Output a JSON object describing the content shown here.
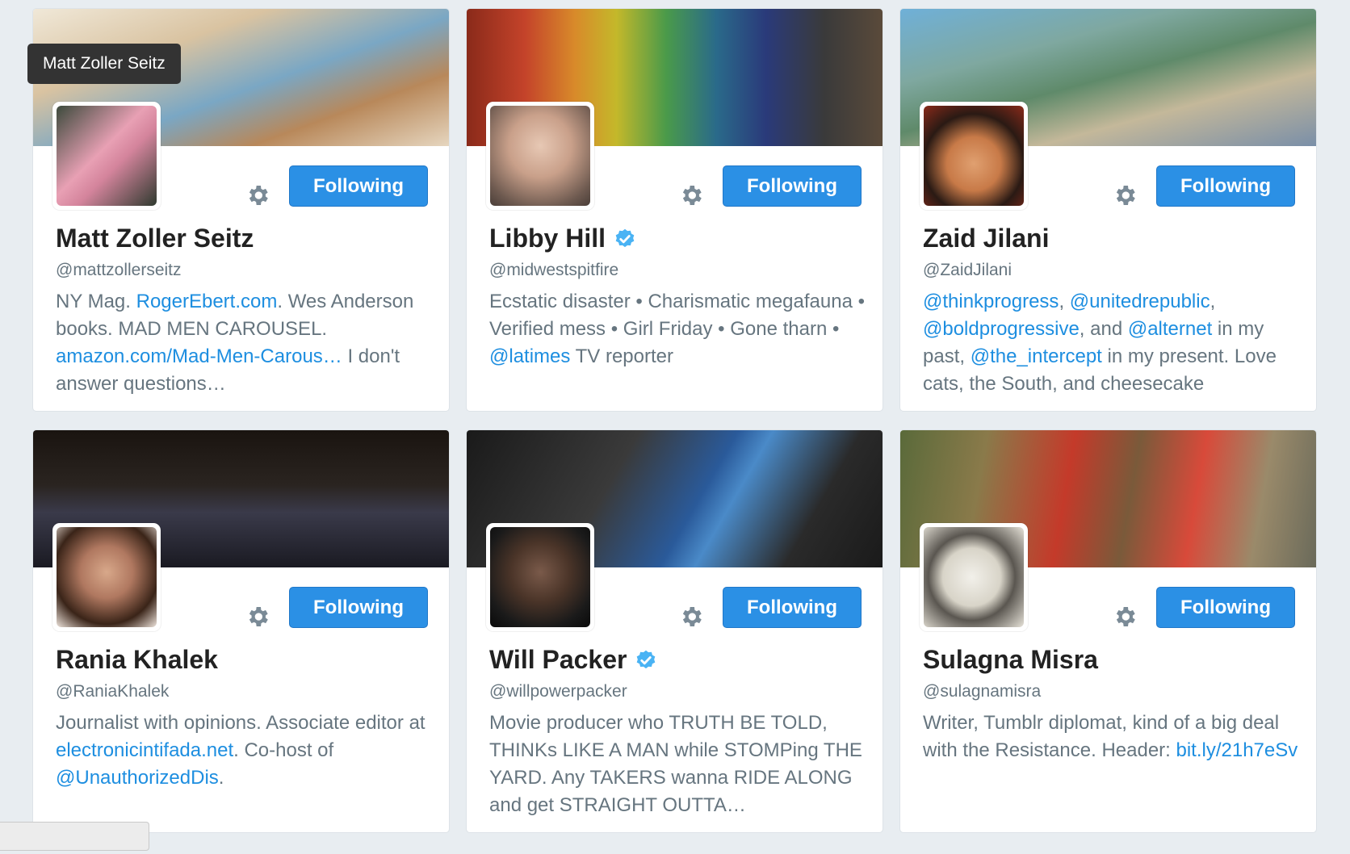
{
  "tooltip": "Matt Zoller Seitz",
  "cards": [
    {
      "name": "Matt Zoller Seitz",
      "handle": "@mattzollerseitz",
      "verified": false,
      "follow_label": "Following",
      "bio": [
        {
          "t": "text",
          "v": "NY Mag. "
        },
        {
          "t": "link",
          "v": "RogerEbert.com"
        },
        {
          "t": "text",
          "v": ". Wes Anderson books. MAD MEN CAROUSEL. "
        },
        {
          "t": "link",
          "v": "amazon.com/Mad-Men-Carous…"
        },
        {
          "t": "text",
          "v": " I don't answer questions…"
        }
      ]
    },
    {
      "name": "Libby Hill",
      "handle": "@midwestspitfire",
      "verified": true,
      "follow_label": "Following",
      "bio": [
        {
          "t": "text",
          "v": "Ecstatic disaster • Charismatic megafauna • Verified mess • Girl Friday • Gone tharn • "
        },
        {
          "t": "link",
          "v": "@latimes"
        },
        {
          "t": "text",
          "v": " TV reporter"
        }
      ]
    },
    {
      "name": "Zaid Jilani",
      "handle": "@ZaidJilani",
      "verified": false,
      "follow_label": "Following",
      "bio": [
        {
          "t": "link",
          "v": "@thinkprogress"
        },
        {
          "t": "text",
          "v": ", "
        },
        {
          "t": "link",
          "v": "@unitedrepublic"
        },
        {
          "t": "text",
          "v": ", "
        },
        {
          "t": "link",
          "v": "@boldprogressive"
        },
        {
          "t": "text",
          "v": ", and "
        },
        {
          "t": "link",
          "v": "@alternet"
        },
        {
          "t": "text",
          "v": " in my past, "
        },
        {
          "t": "link",
          "v": "@the_intercept"
        },
        {
          "t": "text",
          "v": " in my present. Love cats, the South, and cheesecake"
        }
      ]
    },
    {
      "name": "Rania Khalek",
      "handle": "@RaniaKhalek",
      "verified": false,
      "follow_label": "Following",
      "bio": [
        {
          "t": "text",
          "v": "Journalist with opinions. Associate editor at "
        },
        {
          "t": "link",
          "v": "electronicintifada.net"
        },
        {
          "t": "text",
          "v": ". Co-host of "
        },
        {
          "t": "link",
          "v": "@UnauthorizedDis"
        },
        {
          "t": "text",
          "v": "."
        }
      ]
    },
    {
      "name": "Will Packer",
      "handle": "@willpowerpacker",
      "verified": true,
      "follow_label": "Following",
      "bio": [
        {
          "t": "text",
          "v": "Movie producer who TRUTH BE TOLD, THINKs LIKE A MAN while STOMPing THE YARD. Any TAKERS wanna RIDE ALONG and get STRAIGHT OUTTA…"
        }
      ]
    },
    {
      "name": "Sulagna Misra",
      "handle": "@sulagnamisra",
      "verified": false,
      "follow_label": "Following",
      "bio": [
        {
          "t": "text",
          "v": "Writer, Tumblr diplomat, kind of a big deal with the Resistance. Header: "
        },
        {
          "t": "link",
          "v": "bit.ly/21h7eSv"
        }
      ]
    }
  ],
  "colors": {
    "follow_button": "#2b90e5",
    "link": "#1d8ee0",
    "verified_badge": "#4ab3f4",
    "page_background": "#e8edf1"
  },
  "icons": {
    "settings": "gear-icon",
    "verified": "verified-badge-icon"
  }
}
